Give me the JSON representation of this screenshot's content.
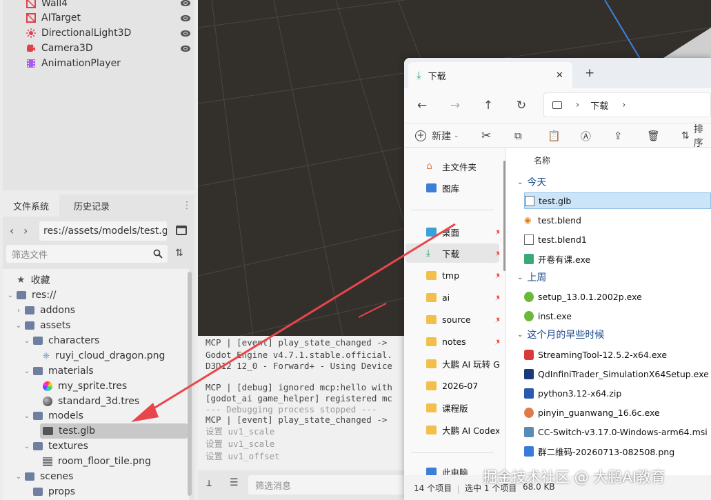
{
  "scene_tree": {
    "items": [
      {
        "label": "Wall4",
        "icon": "mesh-icon",
        "color": "#e0404a"
      },
      {
        "label": "AITarget",
        "icon": "mesh-icon",
        "color": "#e0404a"
      },
      {
        "label": "DirectionalLight3D",
        "icon": "light-icon",
        "color": "#e0404a"
      },
      {
        "label": "Camera3D",
        "icon": "camera-icon",
        "color": "#e0404a"
      },
      {
        "label": "AnimationPlayer",
        "icon": "animation-icon",
        "color": "#a65de6"
      }
    ]
  },
  "filesystem": {
    "tabs": [
      "文件系统",
      "历史记录"
    ],
    "path": "res://assets/models/test.g",
    "filter_placeholder": "筛选文件",
    "tree": [
      {
        "label": "收藏",
        "icon": "star-icon"
      },
      {
        "label": "res://",
        "icon": "folder-icon"
      },
      {
        "label": "addons",
        "icon": "folder-icon"
      },
      {
        "label": "assets",
        "icon": "folder-icon"
      },
      {
        "label": "characters",
        "icon": "folder-icon"
      },
      {
        "label": "ruyi_cloud_dragon.png",
        "icon": "image-icon"
      },
      {
        "label": "materials",
        "icon": "folder-icon"
      },
      {
        "label": "my_sprite.tres",
        "icon": "material-icon"
      },
      {
        "label": "standard_3d.tres",
        "icon": "material-icon"
      },
      {
        "label": "models",
        "icon": "folder-icon"
      },
      {
        "label": "test.glb",
        "icon": "scene-icon"
      },
      {
        "label": "textures",
        "icon": "folder-icon"
      },
      {
        "label": "room_floor_tile.png",
        "icon": "image-icon"
      },
      {
        "label": "scenes",
        "icon": "folder-icon"
      },
      {
        "label": "props",
        "icon": "folder-icon"
      }
    ]
  },
  "output": {
    "lines": [
      "MCP | [event] play_state_changed ->",
      "Godot Engine v4.7.1.stable.official.",
      "D3D12 12_0 - Forward+ - Using Device",
      "",
      "MCP | [debug] ignored mcp:hello with",
      "[godot_ai game_helper] registered mc",
      "--- Debugging process stopped ---",
      "MCP | [event] play_state_changed ->",
      "设置 uv1_scale",
      "设置 uv1_scale",
      "设置 uv1_offset"
    ],
    "filter_placeholder": "筛选消息"
  },
  "explorer": {
    "tab_title": "下载",
    "close": "✕",
    "new_tab": "+",
    "breadcrumb": "下载",
    "toolbar": {
      "new_label": "新建",
      "sort_label": "排序"
    },
    "nav": [
      {
        "label": "主文件夹",
        "icon": "home-icon"
      },
      {
        "label": "图库",
        "icon": "gallery-icon"
      },
      {
        "label": "桌面",
        "icon": "desktop-icon"
      },
      {
        "label": "下载",
        "icon": "download-icon"
      },
      {
        "label": "tmp",
        "icon": "folder-icon"
      },
      {
        "label": "ai",
        "icon": "folder-icon"
      },
      {
        "label": "source",
        "icon": "folder-icon"
      },
      {
        "label": "notes",
        "icon": "folder-icon"
      },
      {
        "label": "大鹏 AI 玩转 Go",
        "icon": "folder-icon"
      },
      {
        "label": "2026-07",
        "icon": "folder-icon"
      },
      {
        "label": "课程版",
        "icon": "folder-icon"
      },
      {
        "label": "大鹏 AI Codex",
        "icon": "folder-icon"
      },
      {
        "label": "此电脑",
        "icon": "computer-icon"
      }
    ],
    "column_header": "名称",
    "groups": [
      {
        "label": "今天",
        "files": [
          "test.glb",
          "test.blend",
          "test.blend1",
          "开卷有课.exe"
        ]
      },
      {
        "label": "上周",
        "files": [
          "setup_13.0.1.2002p.exe",
          "inst.exe"
        ]
      },
      {
        "label": "这个月的早些时候",
        "files": [
          "StreamingTool-12.5.2-x64.exe",
          "QdInfiniTrader_SimulationX64Setup.exe",
          "python3.12-x64.zip",
          "pinyin_guanwang_16.6c.exe",
          "CC-Switch-v3.17.0-Windows-arm64.msi",
          "群二维码-20260713-082508.png"
        ]
      }
    ],
    "status": {
      "count": "14 个项目",
      "selected": "选中 1 个项目",
      "size": "68.0 KB"
    }
  },
  "watermark": "掘金技术社区 @ 大鹏AI教育"
}
